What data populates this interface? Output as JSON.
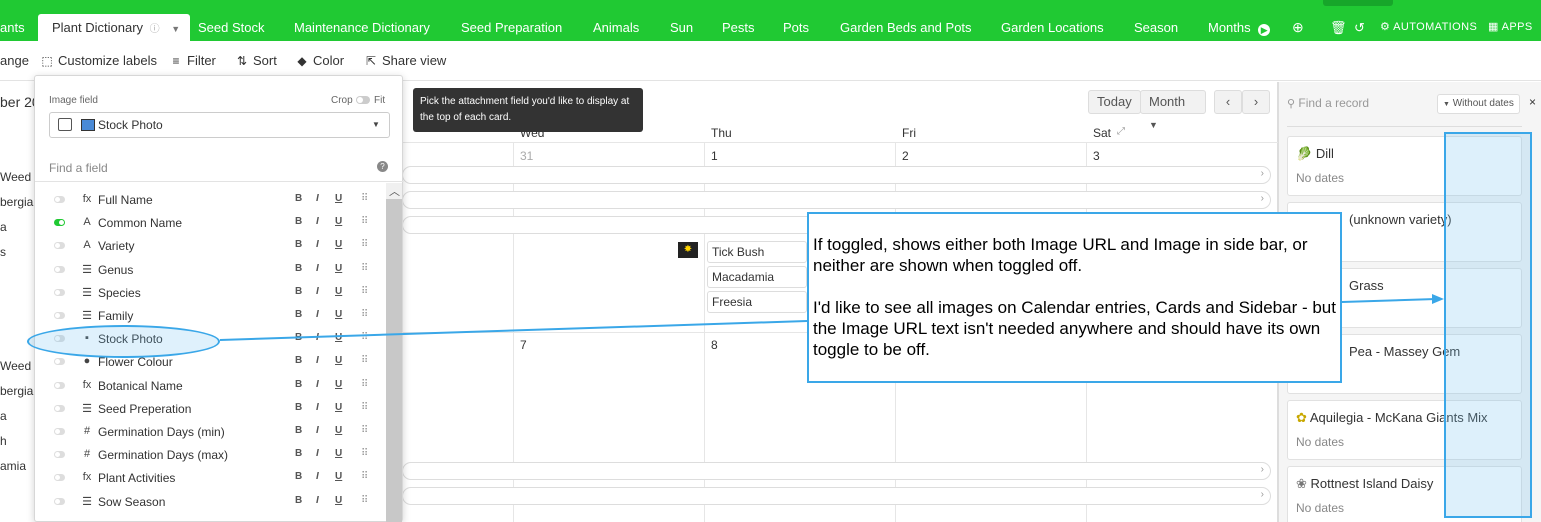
{
  "tabs": [
    {
      "label": "ants",
      "active": false
    },
    {
      "label": "Plant Dictionary",
      "active": true
    },
    {
      "label": "Seed Stock",
      "active": false
    },
    {
      "label": "Maintenance Dictionary",
      "active": false
    },
    {
      "label": "Seed Preparation",
      "active": false
    },
    {
      "label": "Animals",
      "active": false
    },
    {
      "label": "Sun",
      "active": false
    },
    {
      "label": "Pests",
      "active": false
    },
    {
      "label": "Pots",
      "active": false
    },
    {
      "label": "Garden Beds and Pots",
      "active": false
    },
    {
      "label": "Garden Locations",
      "active": false
    },
    {
      "label": "Season",
      "active": false
    },
    {
      "label": "Months",
      "active": false
    }
  ],
  "topright": {
    "automations": "AUTOMATIONS",
    "apps": "APPS"
  },
  "toolbar": {
    "range": "ange",
    "customize": "Customize labels",
    "filter": "Filter",
    "sort": "Sort",
    "color": "Color",
    "share": "Share view"
  },
  "left_labels": [
    "Weed",
    "bergia",
    "a",
    "s",
    "Weed",
    "bergia",
    "a",
    "h",
    "amia"
  ],
  "left_month": "ber 20",
  "panel": {
    "image_field_label": "Image field",
    "crop": "Crop",
    "fit": "Fit",
    "selected_image_field": "Stock Photo",
    "find_placeholder": "Find a field",
    "help": "?",
    "fields": [
      {
        "icon": "fx",
        "name": "Full Name",
        "on": false
      },
      {
        "icon": "A",
        "name": "Common Name",
        "on": true
      },
      {
        "icon": "A",
        "name": "Variety",
        "on": false
      },
      {
        "icon": "☰",
        "name": "Genus",
        "on": false
      },
      {
        "icon": "☰",
        "name": "Species",
        "on": false
      },
      {
        "icon": "☰",
        "name": "Family",
        "on": false
      },
      {
        "icon": "▪",
        "name": "Stock Photo",
        "on": false
      },
      {
        "icon": "●",
        "name": "Flower Colour",
        "on": false
      },
      {
        "icon": "fx",
        "name": "Botanical Name",
        "on": false
      },
      {
        "icon": "☰",
        "name": "Seed Preperation",
        "on": false
      },
      {
        "icon": "#",
        "name": "Germination Days (min)",
        "on": false
      },
      {
        "icon": "#",
        "name": "Germination Days (max)",
        "on": false
      },
      {
        "icon": "fx",
        "name": "Plant Activities",
        "on": false
      },
      {
        "icon": "☰",
        "name": "Sow Season",
        "on": false
      }
    ],
    "fmt": {
      "b": "B",
      "i": "I",
      "u": "U"
    }
  },
  "tooltip": "Pick the attachment field you'd like to display at the top of each card.",
  "calendar": {
    "today": "Today",
    "month": "Month",
    "prev": "‹",
    "next": "›",
    "days": [
      "Wed",
      "Thu",
      "Fri",
      "Sat"
    ],
    "row1_nums": [
      "31",
      "1",
      "2",
      "3"
    ],
    "row2_nums": [
      "7",
      "8"
    ],
    "events": [
      "Tick Bush",
      "Macadamia",
      "Freesia"
    ]
  },
  "sidebar": {
    "search_placeholder": "Find a record",
    "without_dates": "Without dates",
    "close": "×",
    "cards": [
      {
        "title": "Dill",
        "sub": "No dates"
      },
      {
        "title": "(unknown variety)",
        "sub": ""
      },
      {
        "title": "Grass",
        "sub": ""
      },
      {
        "title": "Pea - Massey Gem",
        "sub": ""
      },
      {
        "title": "Aquilegia - McKana Giants Mix",
        "sub": "No dates"
      },
      {
        "title": "Rottnest Island Daisy",
        "sub": "No dates"
      }
    ]
  },
  "callout": {
    "p1": "If toggled, shows either both Image URL and Image in side bar, or neither are shown when toggled off.",
    "p2": "I'd like to see all images on Calendar entries, Cards and Sidebar - but the Image URL text isn't needed anywhere and should have its own toggle to be off."
  },
  "colors": {
    "brand": "#20c933",
    "annotation": "#3aa7e8"
  }
}
